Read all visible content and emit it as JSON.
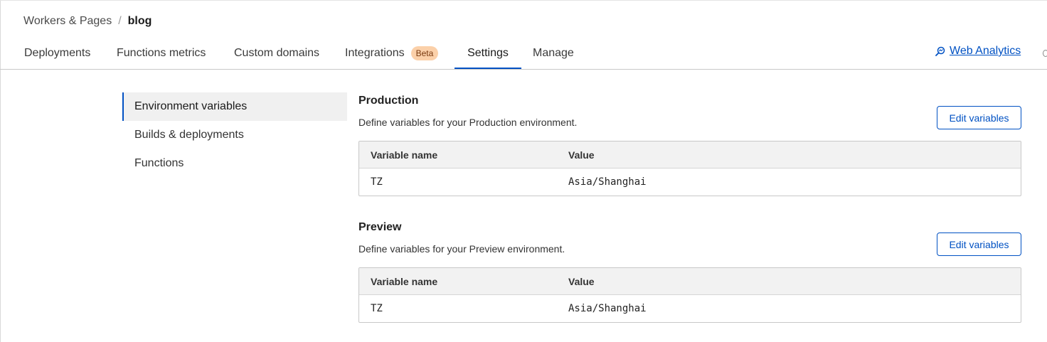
{
  "breadcrumb": {
    "parent": "Workers & Pages",
    "separator": "/",
    "current": "blog"
  },
  "tabs": [
    {
      "label": "Deployments",
      "active": false
    },
    {
      "label": "Functions metrics",
      "active": false
    },
    {
      "label": "Custom domains",
      "active": false
    },
    {
      "label": "Integrations",
      "badge": "Beta",
      "active": false
    },
    {
      "label": "Settings",
      "active": true
    },
    {
      "label": "Manage",
      "active": false
    }
  ],
  "web_analytics": {
    "label": "Web Analytics",
    "icon": "search-analytics-icon"
  },
  "sidebar": {
    "items": [
      {
        "label": "Environment variables",
        "active": true
      },
      {
        "label": "Builds & deployments",
        "active": false
      },
      {
        "label": "Functions",
        "active": false
      }
    ]
  },
  "production": {
    "title": "Production",
    "description": "Define variables for your Production environment.",
    "edit_label": "Edit variables",
    "columns": [
      "Variable name",
      "Value"
    ],
    "rows": [
      {
        "name": "TZ",
        "value": "Asia/Shanghai"
      }
    ]
  },
  "preview": {
    "title": "Preview",
    "description": "Define variables for your Preview environment.",
    "edit_label": "Edit variables",
    "columns": [
      "Variable name",
      "Value"
    ],
    "rows": [
      {
        "name": "TZ",
        "value": "Asia/Shanghai"
      }
    ]
  },
  "colors": {
    "accent": "#0051c3",
    "badge_bg": "#fbd0a9",
    "table_header_bg": "#f2f2f2",
    "sidebar_active_bg": "#f0f0f0"
  }
}
